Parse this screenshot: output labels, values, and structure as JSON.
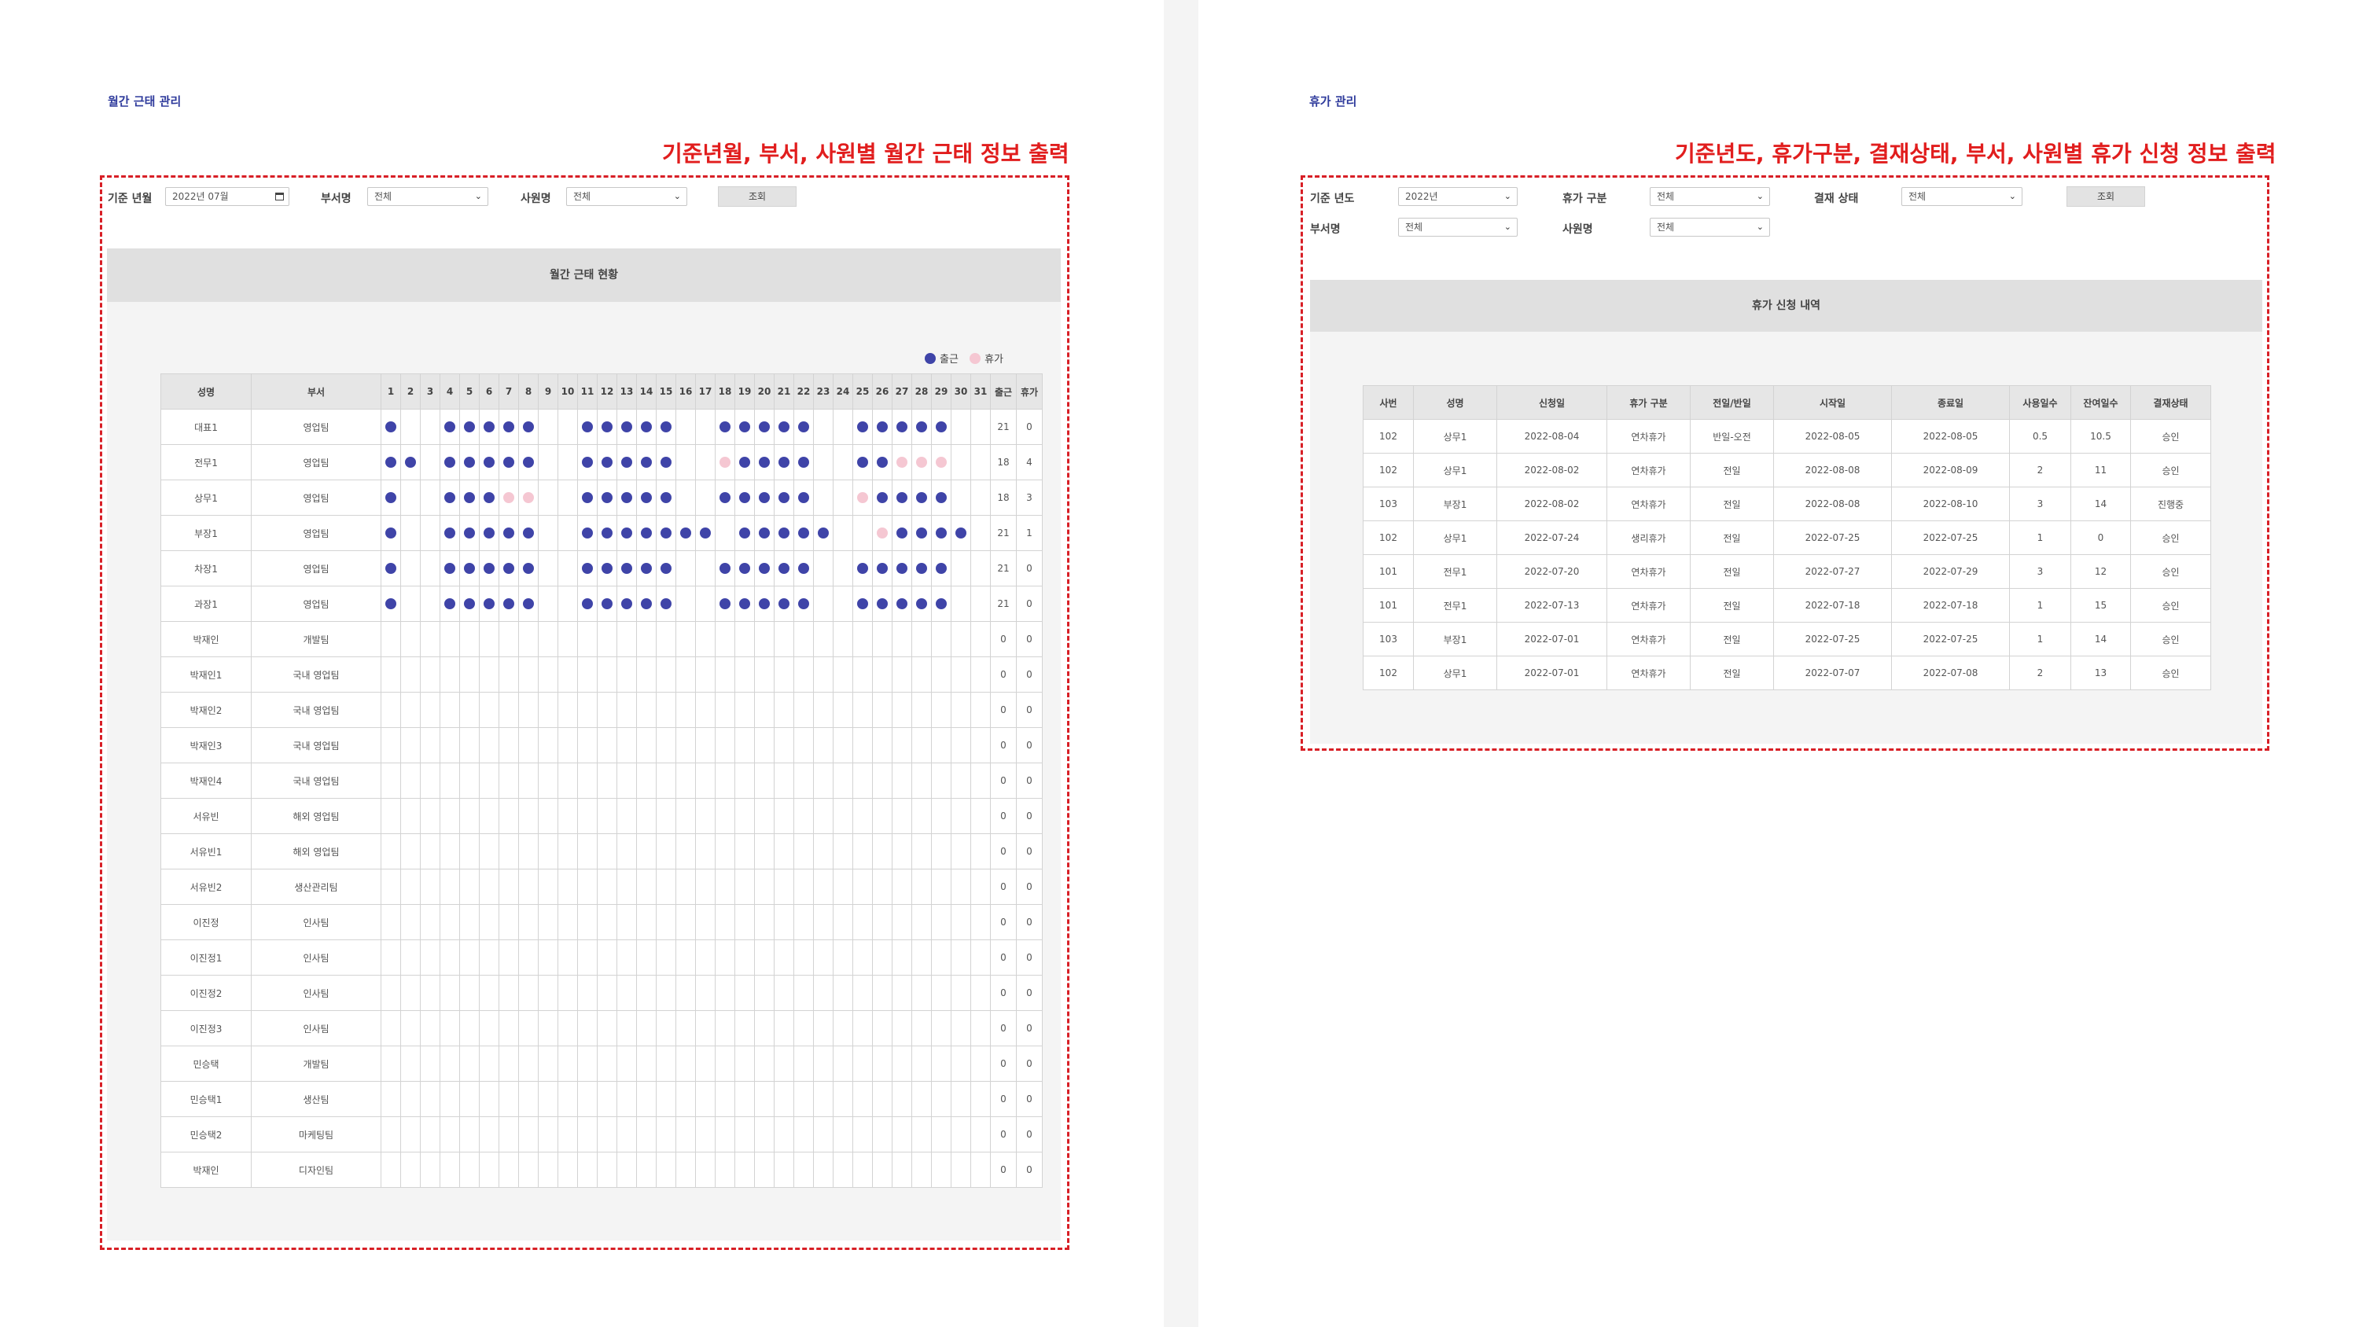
{
  "colors": {
    "attend": "#3f44a8",
    "vacation": "#f5c7d2",
    "annotation": "#e11d1d",
    "title": "#2f3b9c"
  },
  "left": {
    "page_title": "월간 근태 관리",
    "annotation": "기준년월, 부서, 사원별 월간 근태 정보 출력",
    "filters": {
      "month_label": "기준 년월",
      "month_value": "2022년 07월",
      "dept_label": "부서명",
      "dept_value": "전체",
      "emp_label": "사원명",
      "emp_value": "전체",
      "search_button": "조회"
    },
    "panel_title": "월간 근태 현황",
    "legend": {
      "attend": "출근",
      "vacation": "휴가"
    },
    "columns": {
      "name": "성명",
      "dept": "부서",
      "attend": "출근",
      "vacation": "휴가"
    },
    "days": [
      "1",
      "2",
      "3",
      "4",
      "5",
      "6",
      "7",
      "8",
      "9",
      "10",
      "11",
      "12",
      "13",
      "14",
      "15",
      "16",
      "17",
      "18",
      "19",
      "20",
      "21",
      "22",
      "23",
      "24",
      "25",
      "26",
      "27",
      "28",
      "29",
      "30",
      "31"
    ],
    "rows": [
      {
        "name": "대표1",
        "dept": "영업팀",
        "marks": "W..WWWWW..WWWWW..WWWWW..WWWWW..",
        "attend": "21",
        "vacation": "0"
      },
      {
        "name": "전무1",
        "dept": "영업팀",
        "marks": "WW.WWWWW..WWWWW..VWWWW..WWVVV..",
        "attend": "18",
        "vacation": "4"
      },
      {
        "name": "상무1",
        "dept": "영업팀",
        "marks": "W..WWWVV..WWWWW..WWWWW..VWWWW..",
        "attend": "18",
        "vacation": "3"
      },
      {
        "name": "부장1",
        "dept": "영업팀",
        "marks": "W..WWWWW..WWWWWWW.WWWWW..VWWWW..",
        "attend": "21",
        "vacation": "1"
      },
      {
        "name": "차장1",
        "dept": "영업팀",
        "marks": "W..WWWWW..WWWWW..WWWWW..WWWWW..",
        "attend": "21",
        "vacation": "0"
      },
      {
        "name": "과장1",
        "dept": "영업팀",
        "marks": "W..WWWWW..WWWWW..WWWWW..WWWWW..",
        "attend": "21",
        "vacation": "0"
      },
      {
        "name": "박재인",
        "dept": "개발팀",
        "marks": "",
        "attend": "0",
        "vacation": "0"
      },
      {
        "name": "박재인1",
        "dept": "국내 영업팀",
        "marks": "",
        "attend": "0",
        "vacation": "0"
      },
      {
        "name": "박재인2",
        "dept": "국내 영업팀",
        "marks": "",
        "attend": "0",
        "vacation": "0"
      },
      {
        "name": "박재인3",
        "dept": "국내 영업팀",
        "marks": "",
        "attend": "0",
        "vacation": "0"
      },
      {
        "name": "박재인4",
        "dept": "국내 영업팀",
        "marks": "",
        "attend": "0",
        "vacation": "0"
      },
      {
        "name": "서유빈",
        "dept": "해외 영업팀",
        "marks": "",
        "attend": "0",
        "vacation": "0"
      },
      {
        "name": "서유빈1",
        "dept": "해외 영업팀",
        "marks": "",
        "attend": "0",
        "vacation": "0"
      },
      {
        "name": "서유빈2",
        "dept": "생산관리팀",
        "marks": "",
        "attend": "0",
        "vacation": "0"
      },
      {
        "name": "이진정",
        "dept": "인사팀",
        "marks": "",
        "attend": "0",
        "vacation": "0"
      },
      {
        "name": "이진정1",
        "dept": "인사팀",
        "marks": "",
        "attend": "0",
        "vacation": "0"
      },
      {
        "name": "이진정2",
        "dept": "인사팀",
        "marks": "",
        "attend": "0",
        "vacation": "0"
      },
      {
        "name": "이진정3",
        "dept": "인사팀",
        "marks": "",
        "attend": "0",
        "vacation": "0"
      },
      {
        "name": "민승택",
        "dept": "개발팀",
        "marks": "",
        "attend": "0",
        "vacation": "0"
      },
      {
        "name": "민승택1",
        "dept": "생산팀",
        "marks": "",
        "attend": "0",
        "vacation": "0"
      },
      {
        "name": "민승택2",
        "dept": "마케팅팀",
        "marks": "",
        "attend": "0",
        "vacation": "0"
      },
      {
        "name": "박재인",
        "dept": "디자인팀",
        "marks": "",
        "attend": "0",
        "vacation": "0"
      }
    ]
  },
  "right": {
    "page_title": "휴가 관리",
    "annotation": "기준년도, 휴가구분, 결재상태, 부서, 사원별 휴가 신청 정보 출력",
    "filters": {
      "year_label": "기준 년도",
      "year_value": "2022년",
      "type_label": "휴가 구분",
      "type_value": "전체",
      "status_label": "결재 상태",
      "status_value": "전체",
      "search_button": "조회",
      "dept_label": "부서명",
      "dept_value": "전체",
      "emp_label": "사원명",
      "emp_value": "전체"
    },
    "panel_title": "휴가 신청 내역",
    "columns": [
      "사번",
      "성명",
      "신청일",
      "휴가 구분",
      "전일/반일",
      "시작일",
      "종료일",
      "사용일수",
      "잔여일수",
      "결재상태"
    ],
    "rows": [
      [
        "102",
        "상무1",
        "2022-08-04",
        "연차휴가",
        "반일-오전",
        "2022-08-05",
        "2022-08-05",
        "0.5",
        "10.5",
        "승인"
      ],
      [
        "102",
        "상무1",
        "2022-08-02",
        "연차휴가",
        "전일",
        "2022-08-08",
        "2022-08-09",
        "2",
        "11",
        "승인"
      ],
      [
        "103",
        "부장1",
        "2022-08-02",
        "연차휴가",
        "전일",
        "2022-08-08",
        "2022-08-10",
        "3",
        "14",
        "진행중"
      ],
      [
        "102",
        "상무1",
        "2022-07-24",
        "생리휴가",
        "전일",
        "2022-07-25",
        "2022-07-25",
        "1",
        "0",
        "승인"
      ],
      [
        "101",
        "전무1",
        "2022-07-20",
        "연차휴가",
        "전일",
        "2022-07-27",
        "2022-07-29",
        "3",
        "12",
        "승인"
      ],
      [
        "101",
        "전무1",
        "2022-07-13",
        "연차휴가",
        "전일",
        "2022-07-18",
        "2022-07-18",
        "1",
        "15",
        "승인"
      ],
      [
        "103",
        "부장1",
        "2022-07-01",
        "연차휴가",
        "전일",
        "2022-07-25",
        "2022-07-25",
        "1",
        "14",
        "승인"
      ],
      [
        "102",
        "상무1",
        "2022-07-01",
        "연차휴가",
        "전일",
        "2022-07-07",
        "2022-07-08",
        "2",
        "13",
        "승인"
      ]
    ]
  }
}
